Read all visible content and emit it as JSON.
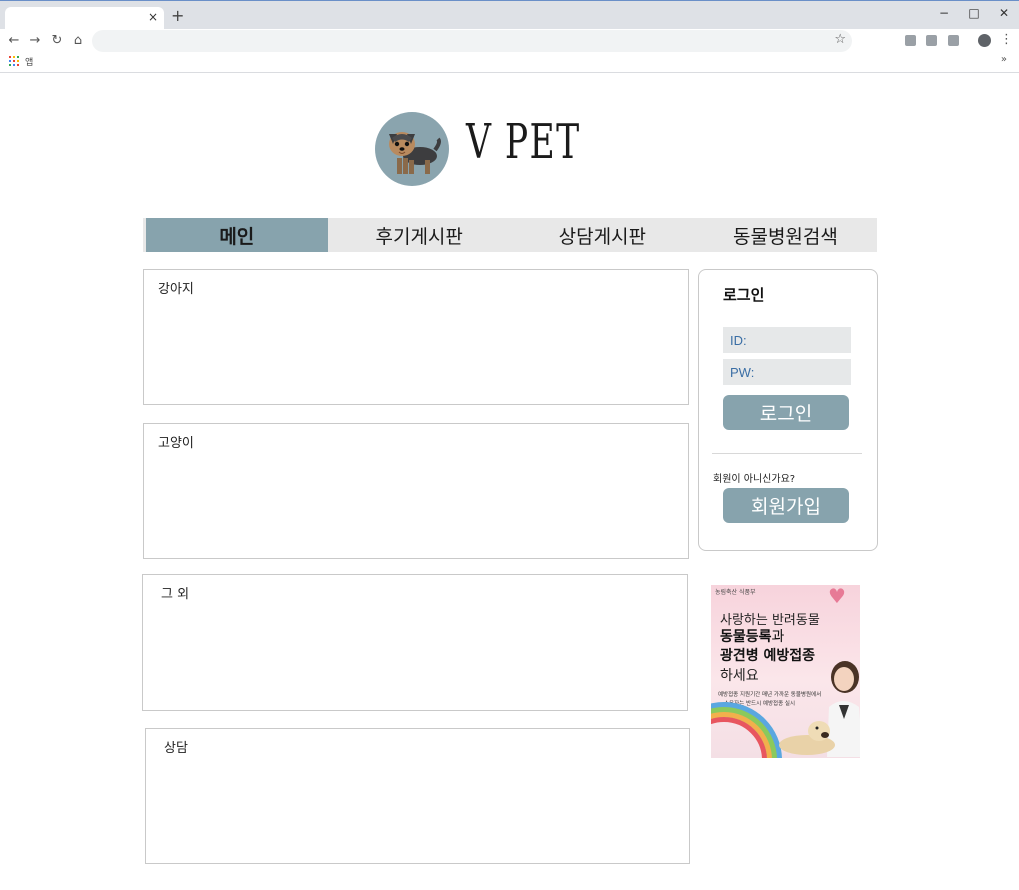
{
  "browser": {
    "tab_title": "",
    "tab_close": "×",
    "new_tab": "+",
    "window_min": "−",
    "window_max": "□",
    "window_close": "✕",
    "back": "←",
    "forward": "→",
    "reload": "↻",
    "home": "⌂",
    "url": "",
    "bookmark_star": "☆",
    "menu": "⋮",
    "apps_label": "앱",
    "bookmarks_more": "»"
  },
  "header": {
    "brand": "V PET",
    "logo_icon": "yorkie-dog-icon"
  },
  "nav": {
    "items": [
      {
        "label": "메인",
        "active": true
      },
      {
        "label": "후기게시판",
        "active": false
      },
      {
        "label": "상담게시판",
        "active": false
      },
      {
        "label": "동물병원검색",
        "active": false
      }
    ]
  },
  "boards": [
    {
      "title": "강아지"
    },
    {
      "title": "고양이"
    },
    {
      "title": "그 외"
    },
    {
      "title": "상담"
    }
  ],
  "login": {
    "title": "로그인",
    "id_placeholder": "ID:",
    "pw_placeholder": "PW:",
    "login_button": "로그인",
    "signup_question": "회원이 아니신가요?",
    "signup_button": "회원가입"
  },
  "ad": {
    "corner": "농림축산 식품부",
    "line1": "사랑하는 반려동물",
    "line2_bold": "동물등록",
    "line2_rest": "과",
    "line3": "광견병 예방접종",
    "line4": "하세요",
    "fine1": "예방접종 지원기간 매년 가까운 동물병원에서",
    "fine2": "소유자는 반드시 예방접종 실시"
  },
  "colors": {
    "accent": "#87a3ad",
    "nav_bg": "#e8e8e8",
    "field_bg": "#e6e8e9",
    "field_text": "#3a6ea5"
  }
}
